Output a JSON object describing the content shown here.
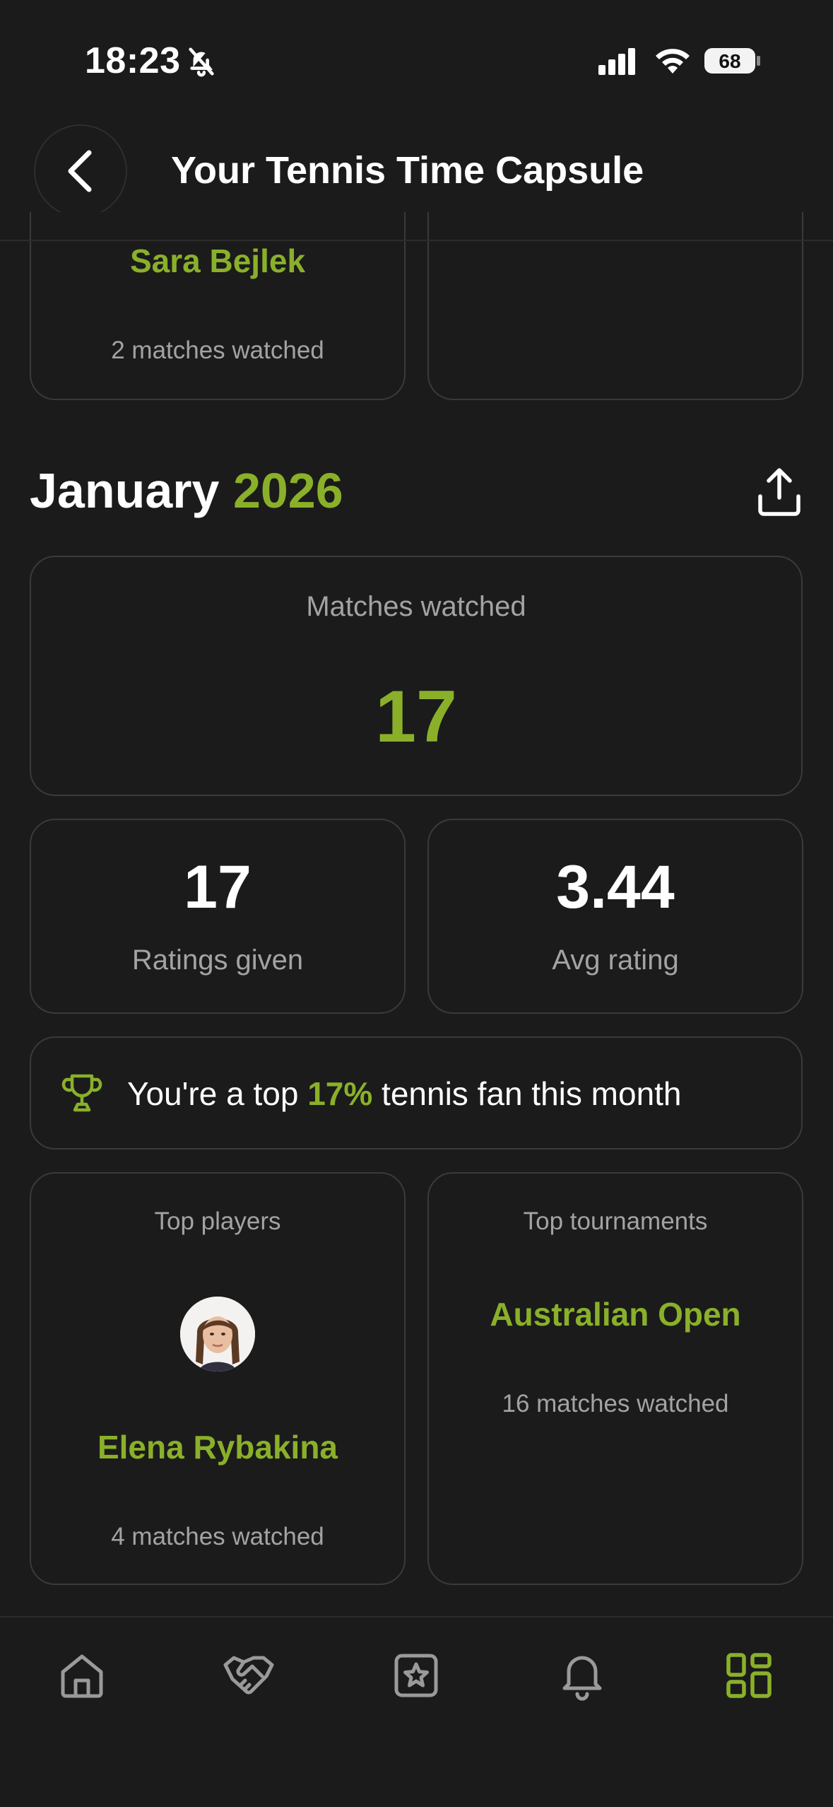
{
  "status": {
    "time": "18:23",
    "battery": "68"
  },
  "header": {
    "title": "Your Tennis Time Capsule"
  },
  "previous_month": {
    "top_player_name": "Sara Bejlek",
    "top_player_sub": "2 matches watched"
  },
  "month": {
    "name": "January",
    "year": "2026",
    "matches_watched_label": "Matches watched",
    "matches_watched_value": "17",
    "ratings_given_value": "17",
    "ratings_given_label": "Ratings given",
    "avg_rating_value": "3.44",
    "avg_rating_label": "Avg rating",
    "fan_prefix": "You're a top ",
    "fan_percent": "17%",
    "fan_suffix": " tennis fan this month",
    "top_players_label": "Top players",
    "top_player_name": "Elena Rybakina",
    "top_player_sub": "4 matches watched",
    "top_tournaments_label": "Top tournaments",
    "top_tournament_name": "Australian Open",
    "top_tournament_sub": "16 matches watched"
  },
  "nav": {
    "items": [
      "home-icon",
      "handshake-icon",
      "star-square-icon",
      "bell-icon",
      "grid-icon"
    ],
    "active": "grid-icon"
  },
  "colors": {
    "accent": "#8ab02a",
    "background": "#1b1b1b",
    "card_border": "#3a3a3a",
    "muted": "#a3a3a3"
  }
}
